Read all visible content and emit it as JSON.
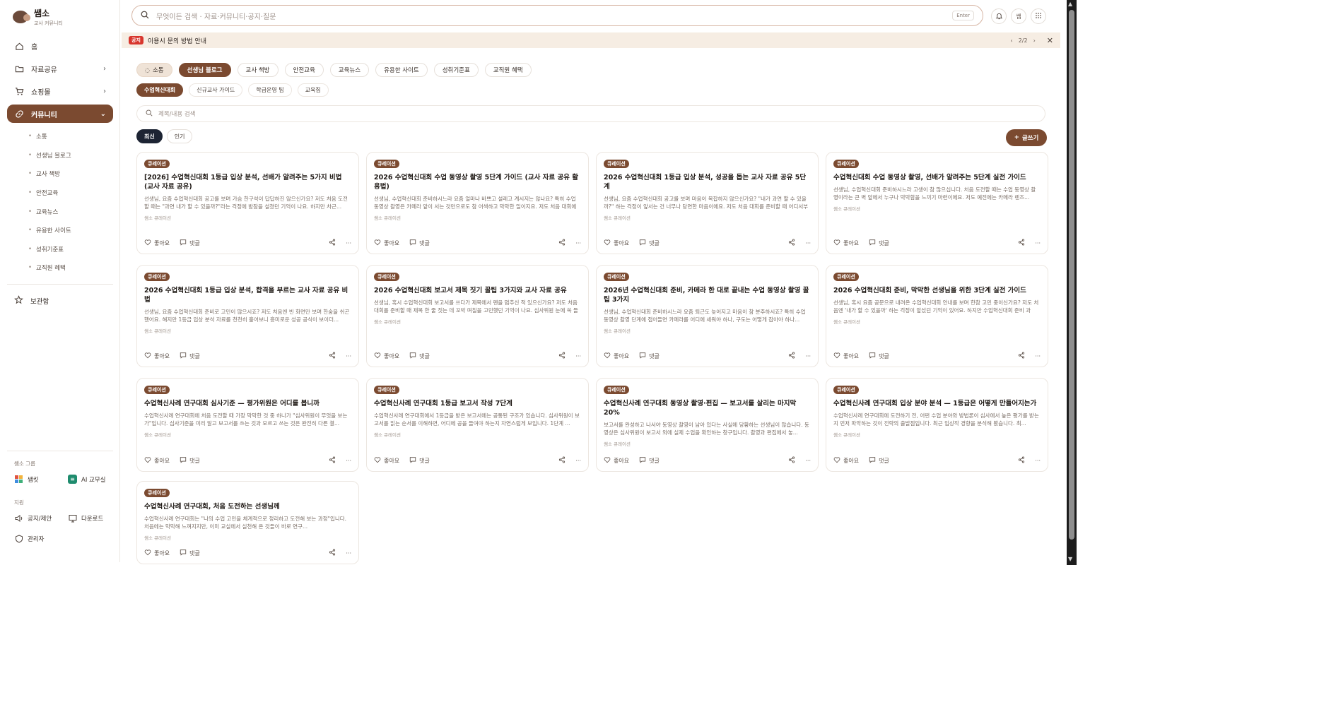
{
  "brand": {
    "name": "쌤소",
    "sub": "교사 커뮤니티"
  },
  "nav": [
    {
      "label": "홈",
      "chev": ""
    },
    {
      "label": "자료공유",
      "chev": "›"
    },
    {
      "label": "쇼핑몰",
      "chev": "›"
    },
    {
      "label": "커뮤니티",
      "chev": "⌄"
    }
  ],
  "subnav": [
    "소통",
    "선생님 블로그",
    "교사 책방",
    "안전교육",
    "교육뉴스",
    "유용한 사이트",
    "성취기준표",
    "교직원 혜택"
  ],
  "favorites": "보관함",
  "groups": {
    "label": "쌤소 그룹",
    "items": [
      "쌤킷",
      "AI 교무실"
    ],
    "support_label": "지원",
    "support": [
      "공지/제안",
      "다운로드"
    ],
    "admin": "관리자"
  },
  "search": {
    "placeholder": "무엇이든 검색 · 자료·커뮤니티·공지·질문",
    "enter": "Enter"
  },
  "top_icons": {
    "user": "쌤"
  },
  "notice": {
    "badge": "공지",
    "text": "이용시 문의 방법 안내",
    "page": "2/2",
    "prev": "‹",
    "next": "›",
    "close": "✕"
  },
  "tabs": [
    "소통",
    "선생님 블로그",
    "교사 책방",
    "안전교육",
    "교육뉴스",
    "유용한 사이트",
    "성취기준표",
    "교직원 혜택"
  ],
  "subtabs": [
    "수업혁신대회",
    "신규교사 가이드",
    "학급운영 팁",
    "교육집"
  ],
  "post_search": {
    "placeholder": "제목/내용 검색"
  },
  "sort": [
    "최신",
    "인기"
  ],
  "write": "글쓰기",
  "card_labels": {
    "like": "좋아요",
    "comment": "댓글"
  },
  "posts": [
    {
      "badge": "큐레이션",
      "title": "[2026] 수업혁신대회 1등급 입상 분석, 선배가 알려주는 5가지 비법 (교사 자료 공유)",
      "desc": "선생님, 요즘 수업혁신대회 공고를 보며 가슴 한구석이 답답하진 않으신가요? 저도 처음 도전할 때는 \"과연 내가 할 수 있을까?\"라는 걱정에 밤잠을 설쳤던 기억이 나요. 하지만 차근...",
      "author": "쌤소 큐레이션"
    },
    {
      "badge": "큐레이션",
      "title": "2026 수업혁신대회 수업 동영상 촬영 5단계 가이드 (교사 자료 공유 활용법)",
      "desc": "선생님, 수업혁신대회 준비하시느라 요즘 얼마나 바쁘고 설레고 계시지는 않나요? 특히 수업 동영상 촬영은 카메라 앞이 서는 것만으로도 참 어색하고 막막한 일이지요. 저도 처음 대회에 나...",
      "author": "쌤소 큐레이션"
    },
    {
      "badge": "큐레이션",
      "title": "2026 수업혁신대회 1등급 입상 분석, 성공을 돕는 교사 자료 공유 5단계",
      "desc": "선생님, 요즘 수업혁신대회 공고를 보며 마음이 복잡하지 않으신가요? \"내가 과연 할 수 있을까?\" 하는 걱정이 앞서는 건 너무나 당연한 마음이에요. 저도 처음 대회를 준비할 때 어디서부터...",
      "author": "쌤소 큐레이션"
    },
    {
      "badge": "큐레이션",
      "title": "수업혁신대회 수업 동영상 촬영, 선배가 알려주는 5단계 실전 가이드",
      "desc": "선생님, 수업혁신대회 준비하시느라 고생이 참 많으십니다. 처음 도전할 때는 수업 동영상 촬영이라는 큰 벽 앞에서 누구나 막막함을 느끼기 마련이에요. 저도 예전에는 카메라 렌즈...",
      "author": "쌤소 큐레이션"
    },
    {
      "badge": "큐레이션",
      "title": "2026 수업혁신대회 1등급 입상 분석, 합격을 부르는 교사 자료 공유 비법",
      "desc": "선생님, 요즘 수업혁신대회 준비로 고민이 많으시죠? 저도 처음엔 빈 화면만 보며 한숨을 쉬곤 했어요. 해지만 1등급 입상 분석 자료를 천천히 훑어보니 흥미로운 성공 공식이 보이더...",
      "author": "쌤소 큐레이션"
    },
    {
      "badge": "큐레이션",
      "title": "2026 수업혁신대회 보고서 제목 짓기 꿀팁 3가지와 교사 자료 공유",
      "desc": "선생님, 혹시 수업혁신대회 보고서를 쓰다가 제목에서 펜을 멈추신 적 있으신가요? 저도 처음 대회를 준비할 때 제목 한 줄 짓는 데 꼬박 며칠을 고민했던 기억이 나요. 심사위원 눈에 쏙 들어오...",
      "author": "쌤소 큐레이션"
    },
    {
      "badge": "큐레이션",
      "title": "2026년 수업혁신대회 준비, 카메라 한 대로 끝내는 수업 동영상 촬영 꿀팁 3가지",
      "desc": "선생님, 수업혁신대회 준비하시느라 요즘 퇴근도 늦어지고 마음이 참 분주하시죠? 특히 수업 동영상 촬영 단계에 접어들면 카메라를 어디에 세워야 하나, 구도는 어떻게 잡아야 하나...",
      "author": "쌤소 큐레이션"
    },
    {
      "badge": "큐레이션",
      "title": "2026 수업혁신대회 준비, 막막한 선생님을 위한 3단계 실전 가이드",
      "desc": "선생님, 혹시 요즘 공문으로 내려온 수업혁신대회 안내를 보며 한참 고민 중이신가요? 저도 처음엔 '내가 할 수 있을까' 하는 걱정이 앞섰던 기억이 있어요. 하지만 수업혁신대회 준비 과정...",
      "author": "쌤소 큐레이션"
    },
    {
      "badge": "큐레이션",
      "title": "수업혁신사례 연구대회 심사기준 — 평가위원은 어디를 봅니까",
      "desc": "수업혁신사례 연구대회에 처음 도전할 때 가장 막막한 것 중 하나가 \"심사위원이 무엇을 보는가\"입니다. 심사기준을 미리 알고 보고서를 쓰는 것과 모르고 쓰는 것은 완전히 다른 결...",
      "author": "쌤소 큐레이션"
    },
    {
      "badge": "큐레이션",
      "title": "수업혁신사례 연구대회 1등급 보고서 작성 7단계",
      "desc": "수업혁신사례 연구대회에서 1등급을 받은 보고서에는 공통된 구조가 있습니다. 심사위원이 보고서를 읽는 순서를 이해하면, 어디에 공을 들여야 하는지 자연스럽게 보입니다. 1단계 ...",
      "author": "쌤소 큐레이션"
    },
    {
      "badge": "큐레이션",
      "title": "수업혁신사례 연구대회 동영상 촬영·편집 — 보고서를 살리는 마지막 20%",
      "desc": "보고서를 완성하고 나서야 동영상 촬영이 남아 있다는 사실에 당황하는 선생님이 많습니다. 동영상은 심사위원이 보고서 외에 실제 수업을 확인하는 창구입니다. 촬영과 편집에서 놓...",
      "author": "쌤소 큐레이션"
    },
    {
      "badge": "큐레이션",
      "title": "수업혁신사례 연구대회 입상 분야 분석 — 1등급은 어떻게 만들어지는가",
      "desc": "수업혁신사례 연구대회에 도전하기 전, 어떤 수업 분야와 방법론이 심사에서 높은 평가를 받는지 먼저 파악하는 것이 전략의 출발점입니다. 최근 입상작 경향을 분석해 봤습니다. 최...",
      "author": "쌤소 큐레이션"
    },
    {
      "badge": "큐레이션",
      "title": "수업혁신사례 연구대회, 처음 도전하는 선생님께",
      "desc": "수업혁신사례 연구대회는 \"나의 수업 고민을 체계적으로 정리하고 도전해 보는 과정\"입니다. 처음에는 막막해 느껴지지만, 이미 교실에서 실천해 온 것들이 바로 연구...",
      "author": "쌤소 큐레이션"
    }
  ]
}
